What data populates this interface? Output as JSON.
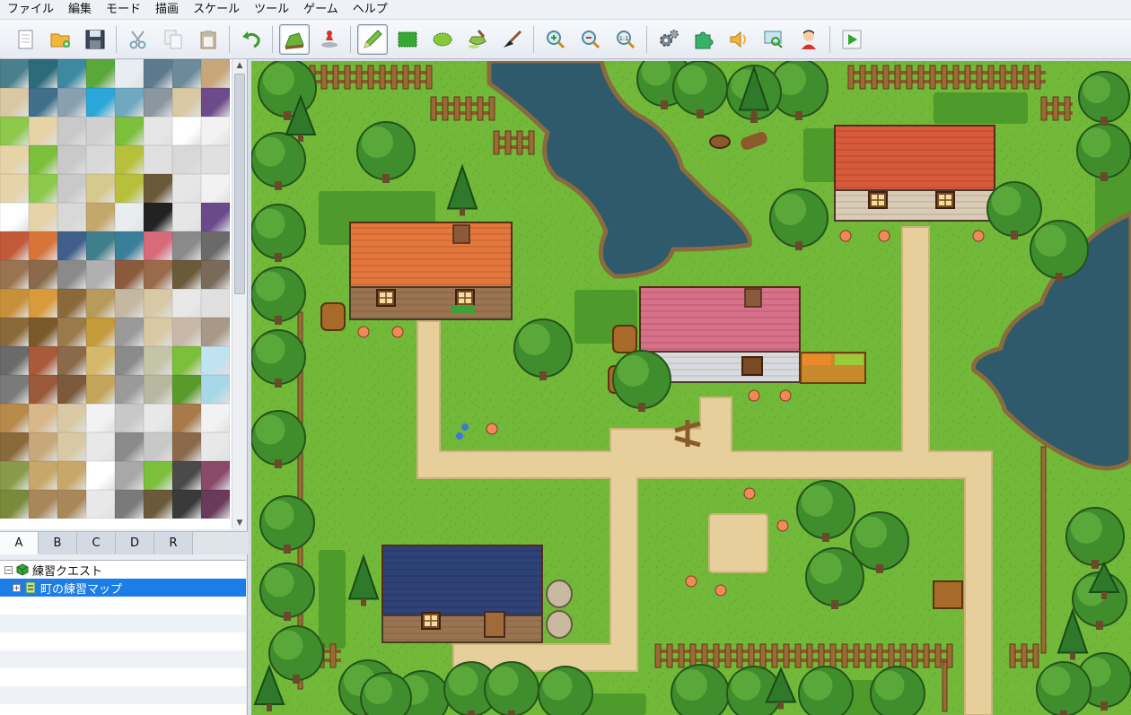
{
  "menu": [
    "ファイル",
    "編集",
    "モード",
    "描画",
    "スケール",
    "ツール",
    "ゲーム",
    "ヘルプ"
  ],
  "toolbar": {
    "buttons": [
      {
        "name": "new-project-button",
        "icon": "new-page-icon"
      },
      {
        "name": "open-project-button",
        "icon": "open-folder-icon"
      },
      {
        "name": "save-project-button",
        "icon": "floppy-disk-icon"
      },
      {
        "name": "cut-button",
        "icon": "scissors-icon"
      },
      {
        "name": "copy-button",
        "icon": "copy-icon"
      },
      {
        "name": "paste-button",
        "icon": "clipboard-icon"
      },
      {
        "name": "undo-button",
        "icon": "undo-arrow-icon"
      },
      {
        "name": "map-mode-button",
        "icon": "map-mode-icon",
        "active": true
      },
      {
        "name": "event-mode-button",
        "icon": "event-mode-icon"
      },
      {
        "name": "pencil-tool-button",
        "icon": "pencil-icon",
        "active": true
      },
      {
        "name": "rectangle-tool-button",
        "icon": "rectangle-icon"
      },
      {
        "name": "ellipse-tool-button",
        "icon": "ellipse-icon"
      },
      {
        "name": "flood-fill-tool-button",
        "icon": "paint-bucket-icon"
      },
      {
        "name": "shadow-pen-tool-button",
        "icon": "shadow-pen-icon"
      },
      {
        "name": "zoom-in-button",
        "icon": "zoom-in-icon"
      },
      {
        "name": "zoom-out-button",
        "icon": "zoom-out-icon"
      },
      {
        "name": "actual-size-button",
        "icon": "zoom-actual-icon",
        "label": "1:1"
      },
      {
        "name": "database-button",
        "icon": "gears-icon"
      },
      {
        "name": "plugin-manager-button",
        "icon": "puzzle-icon"
      },
      {
        "name": "sound-test-button",
        "icon": "speaker-icon"
      },
      {
        "name": "event-searcher-button",
        "icon": "search-screen-icon"
      },
      {
        "name": "character-generator-button",
        "icon": "character-icon"
      },
      {
        "name": "playtest-button",
        "icon": "play-icon"
      }
    ]
  },
  "palette_tabs": [
    "A",
    "B",
    "C",
    "D",
    "R"
  ],
  "active_tab": "A",
  "tree": {
    "project": "練習クエスト",
    "maps": [
      "町の練習マップ"
    ]
  },
  "colors": {
    "grass": "#72b93a",
    "grass_dark": "#4e9a2a",
    "water": "#2f5a6b",
    "water_edge": "#8a6b3d",
    "path": "#e6cf9a",
    "fence": "#8b5a2b",
    "roof_orange": "#e4773c",
    "roof_red": "#d85a3a",
    "roof_pink": "#d8708a",
    "roof_blue": "#2f4277",
    "wall_brick": "#9a7450",
    "wall_stone": "#d9dade",
    "tree": "#3f8d2c",
    "selection": "#1d7de6"
  }
}
